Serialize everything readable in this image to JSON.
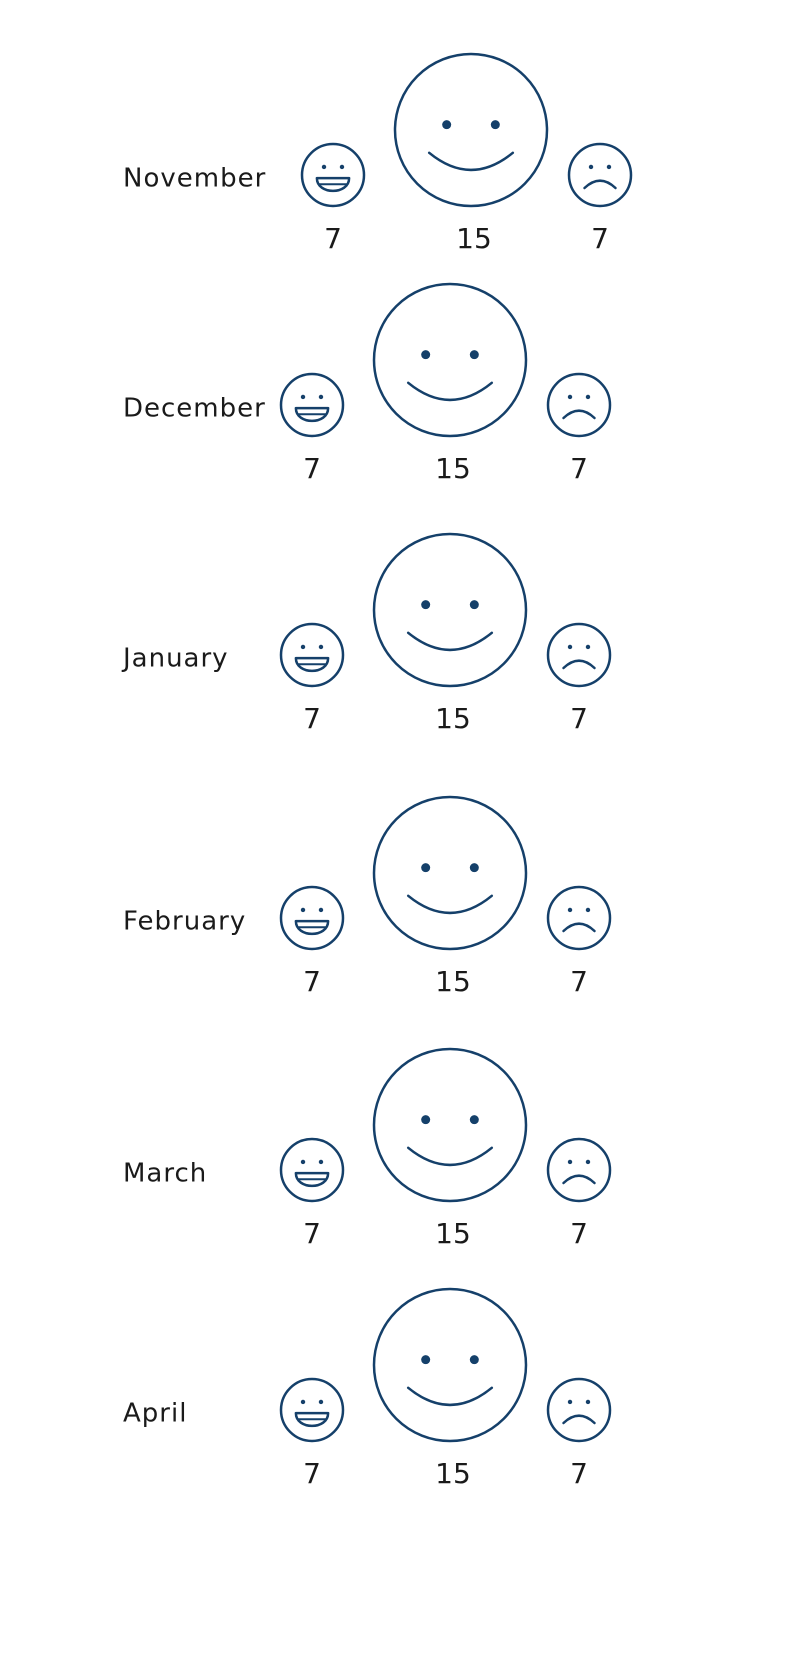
{
  "chart_data": {
    "type": "table",
    "colors": {
      "face_stroke": "#15406a",
      "text": "#1a1a1a",
      "background": "#ffffff"
    },
    "rows": [
      {
        "month": "November",
        "very_happy": 7,
        "happy": 15,
        "sad": 7
      },
      {
        "month": "December",
        "very_happy": 7,
        "happy": 15,
        "sad": 7
      },
      {
        "month": "January",
        "very_happy": 7,
        "happy": 15,
        "sad": 7
      },
      {
        "month": "February",
        "very_happy": 7,
        "happy": 15,
        "sad": 7
      },
      {
        "month": "March",
        "very_happy": 7,
        "happy": 15,
        "sad": 7
      },
      {
        "month": "April",
        "very_happy": 7,
        "happy": 15,
        "sad": 7
      }
    ],
    "icons": [
      "grin-face-icon",
      "smile-face-icon",
      "frown-face-icon"
    ]
  }
}
